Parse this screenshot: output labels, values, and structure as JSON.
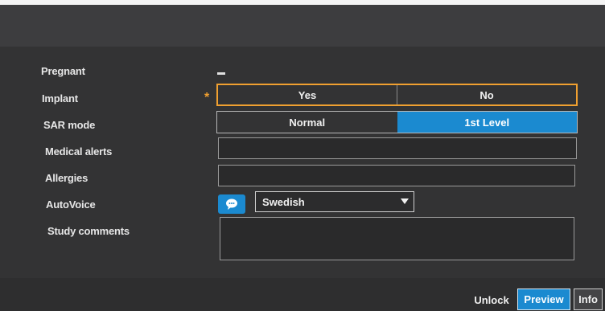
{
  "form": {
    "pregnant": {
      "label": "Pregnant"
    },
    "implant": {
      "label": "Implant",
      "required_mark": "*",
      "options": [
        "Yes",
        "No"
      ],
      "selected": ""
    },
    "sar_mode": {
      "label": "SAR mode",
      "options": [
        "Normal",
        "1st Level"
      ],
      "selected": "1st Level"
    },
    "medical_alerts": {
      "label": "Medical alerts",
      "value": ""
    },
    "allergies": {
      "label": "Allergies",
      "value": ""
    },
    "autovoice": {
      "label": "AutoVoice",
      "language": "Swedish"
    },
    "study_comments": {
      "label": "Study comments",
      "value": ""
    }
  },
  "footer": {
    "unlock": "Unlock",
    "preview": "Preview",
    "info": "Info"
  },
  "colors": {
    "accent": "#1b8ad0",
    "required": "#f0a030"
  },
  "icons": {
    "autovoice_button": "speech-bubble-icon",
    "language_select": "chevron-down-icon"
  }
}
